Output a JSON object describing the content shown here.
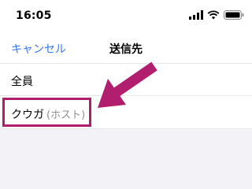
{
  "status_bar": {
    "time": "16:05"
  },
  "nav": {
    "cancel_label": "キャンセル",
    "title": "送信先"
  },
  "recipients": [
    {
      "label": "全員",
      "suffix": ""
    },
    {
      "label": "クウガ",
      "suffix": "(ホスト)"
    }
  ],
  "colors": {
    "accent": "#3478f6",
    "annotation": "#b21e6e"
  }
}
